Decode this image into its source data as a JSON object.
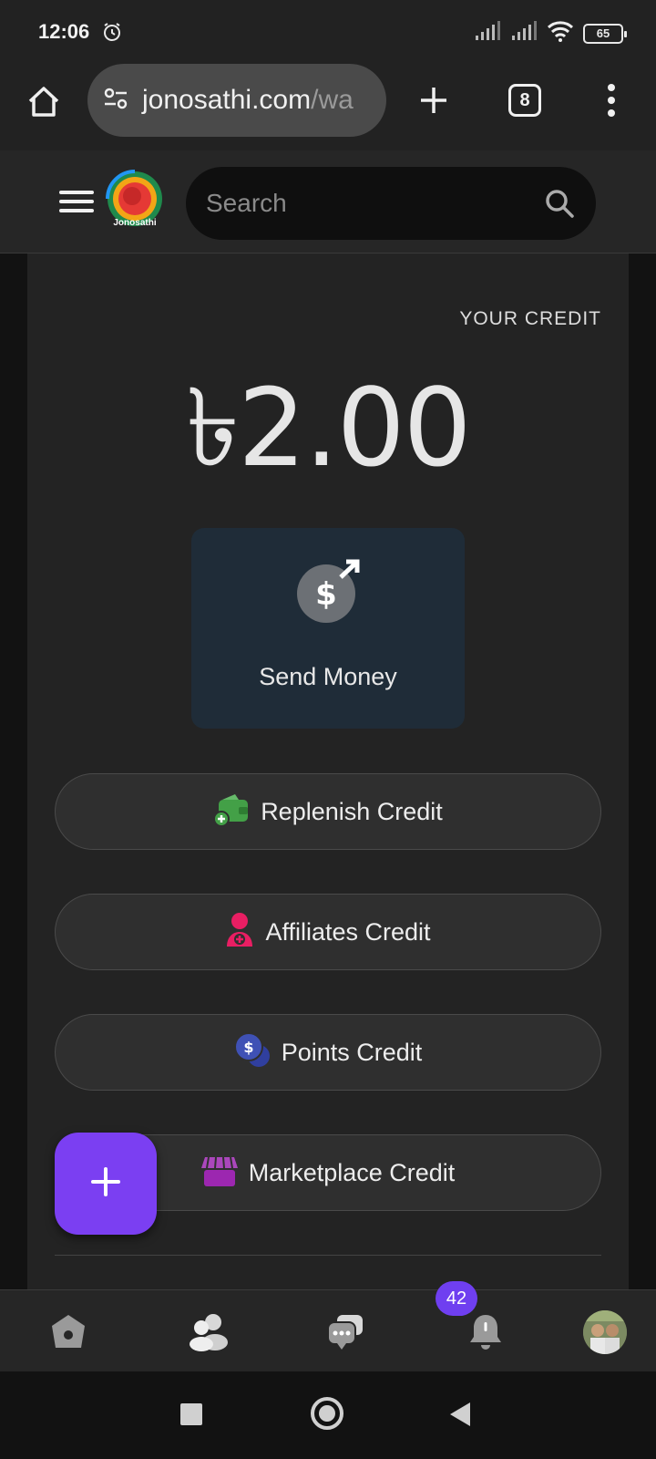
{
  "status_bar": {
    "time": "12:06",
    "battery": "65"
  },
  "browser": {
    "url_main": "jonosathi.com",
    "url_rest": "/wa",
    "tab_count": "8"
  },
  "header": {
    "logo_text": "Jonosathi",
    "search_placeholder": "Search"
  },
  "wallet": {
    "credit_label": "YOUR CREDIT",
    "credit_amount": "৳2.00",
    "send_money_label": "Send Money",
    "buttons": [
      {
        "label": "Replenish Credit",
        "icon": "wallet-plus-icon",
        "color": "#4caf50"
      },
      {
        "label": "Affiliates Credit",
        "icon": "user-plus-icon",
        "color": "#e91e63"
      },
      {
        "label": "Points Credit",
        "icon": "coins-icon",
        "color": "#3f51b5"
      },
      {
        "label": "Marketplace Credit",
        "icon": "store-icon",
        "color": "#9c27b0"
      }
    ]
  },
  "bottom_nav": {
    "notification_count": "42"
  },
  "colors": {
    "accent": "#7b3ff2",
    "card_bg": "#1f2c38"
  }
}
